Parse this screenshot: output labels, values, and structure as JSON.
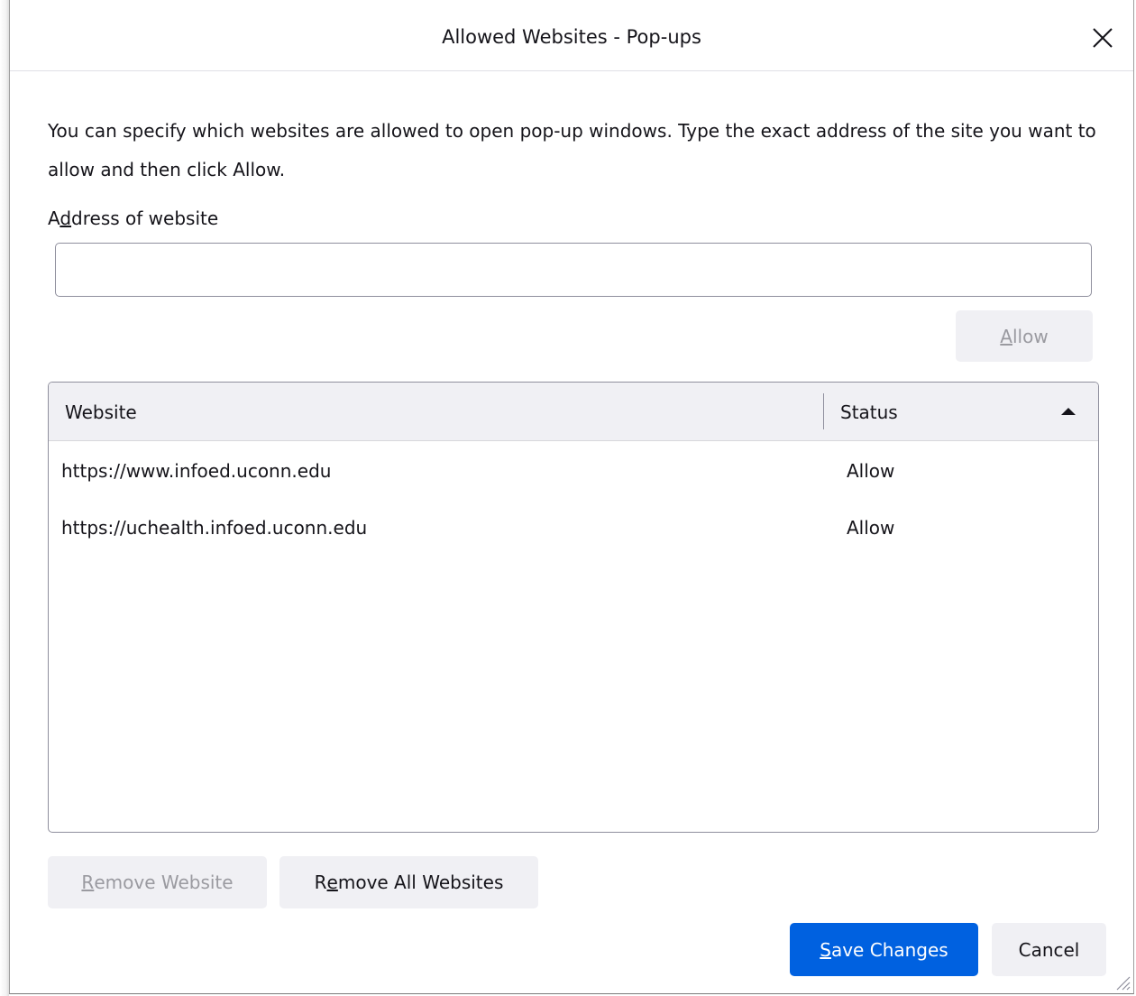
{
  "dialog": {
    "title": "Allowed Websites - Pop-ups",
    "description": "You can specify which websites are allowed to open pop-up windows. Type the exact address of the site you want to allow and then click Allow.",
    "address_label_accesskey": "d",
    "address_label_pre": "A",
    "address_label_post": "dress of website",
    "address_value": "",
    "allow_button": {
      "accesskey": "A",
      "rest": "llow"
    },
    "table": {
      "columns": [
        "Website",
        "Status"
      ],
      "sort_indicator": "sort-ascending-icon",
      "rows": [
        {
          "website": "https://www.infoed.uconn.edu",
          "status": "Allow"
        },
        {
          "website": "https://uchealth.infoed.uconn.edu",
          "status": "Allow"
        }
      ]
    },
    "remove_website_button": {
      "accesskey": "R",
      "rest": "emove Website"
    },
    "remove_all_button": {
      "pre": "R",
      "accesskey": "e",
      "rest": "move All Websites"
    },
    "save_button": {
      "accesskey": "S",
      "rest": "ave Changes"
    },
    "cancel_button": "Cancel"
  },
  "colors": {
    "accent": "#0061e0",
    "button_bg": "#f0f0f4",
    "disabled_text": "#9a9aa0",
    "text": "#15141a"
  }
}
